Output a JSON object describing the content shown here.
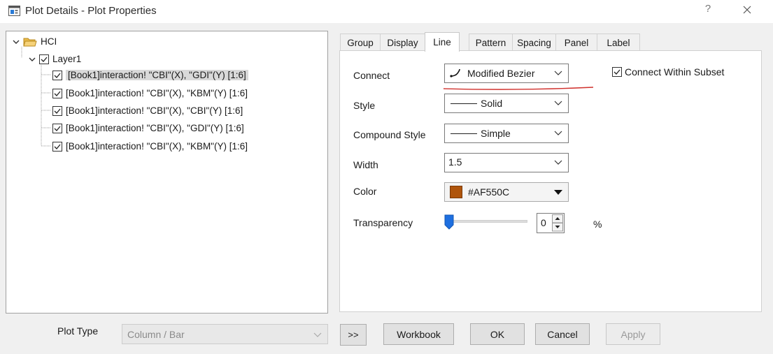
{
  "window": {
    "title": "Plot Details - Plot Properties",
    "help_glyph": "?"
  },
  "tree": {
    "root": "HCI",
    "layer": "Layer1",
    "plots": [
      "[Book1]interaction! \"CBI\"(X), \"GDI\"(Y) [1:6]",
      "[Book1]interaction! \"CBI\"(X), \"KBM\"(Y) [1:6]",
      "[Book1]interaction! \"CBI\"(X), \"CBI\"(Y) [1:6]",
      "[Book1]interaction! \"CBI\"(X), \"GDI\"(Y) [1:6]",
      "[Book1]interaction! \"CBI\"(X), \"KBM\"(Y) [1:6]"
    ]
  },
  "tabs": [
    "Group",
    "Display",
    "Line",
    "Pattern",
    "Spacing",
    "Panel",
    "Label"
  ],
  "active_tab": "Line",
  "line": {
    "connect_label": "Connect",
    "connect_value": "Modified Bezier",
    "connect_within_subset": "Connect Within Subset",
    "style_label": "Style",
    "style_value": "Solid",
    "compound_label": "Compound Style",
    "compound_value": "Simple",
    "width_label": "Width",
    "width_value": "1.5",
    "color_label": "Color",
    "color_value": "#AF550C",
    "transparency_label": "Transparency",
    "transparency_value": "0",
    "transparency_unit": "%"
  },
  "bottom": {
    "plot_type_label": "Plot Type",
    "plot_type_value": "Column / Bar",
    "expand_btn": ">>",
    "workbook_btn": "Workbook",
    "ok_btn": "OK",
    "cancel_btn": "Cancel",
    "apply_btn": "Apply"
  },
  "colors": {
    "line_color": "#AF550C",
    "annotation_underline": "#d0312d",
    "selection_bg": "#d9d9d9",
    "slider_thumb": "#1e6fe0"
  },
  "icons": {
    "app": "plot-details-window-icon",
    "root": "open-folder-icon",
    "connect": "bezier-curve-icon"
  }
}
